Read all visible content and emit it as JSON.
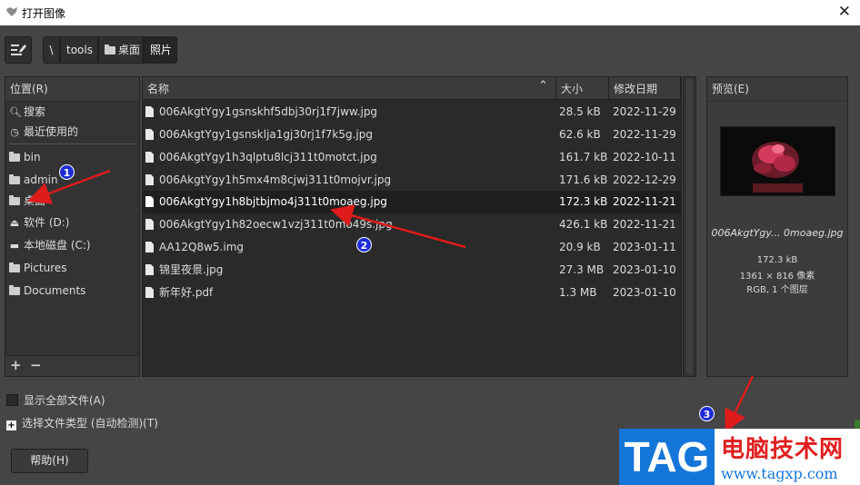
{
  "window": {
    "title": "打开图像",
    "close_icon": "close-icon"
  },
  "breadcrumb": {
    "items": [
      "\\",
      "tools",
      "桌面",
      "照片"
    ]
  },
  "places": {
    "header": "位置(R)",
    "items": [
      {
        "label": "搜索",
        "icon": "search-icon"
      },
      {
        "label": "最近使用的",
        "icon": "recent-icon"
      },
      {
        "label": "bin",
        "icon": "folder-icon"
      },
      {
        "label": "admin",
        "icon": "folder-icon"
      },
      {
        "label": "桌面",
        "icon": "folder-icon"
      },
      {
        "label": "软件 (D:)",
        "icon": "drive-icon"
      },
      {
        "label": "本地磁盘 (C:)",
        "icon": "drive-icon"
      },
      {
        "label": "Pictures",
        "icon": "folder-icon"
      },
      {
        "label": "Documents",
        "icon": "folder-icon"
      }
    ],
    "add_label": "+",
    "remove_label": "−"
  },
  "files": {
    "columns": {
      "name": "名称",
      "size": "大小",
      "date": "修改日期"
    },
    "rows": [
      {
        "name": "006AkgtYgy1gsnskhf5dbj30rj1f7jww.jpg",
        "size": "28.5 kB",
        "date": "2022-11-29"
      },
      {
        "name": "006AkgtYgy1gsnsklja1gj30rj1f7k5g.jpg",
        "size": "62.6 kB",
        "date": "2022-11-29"
      },
      {
        "name": "006AkgtYgy1h3qlptu8lcj311t0motct.jpg",
        "size": "161.7 kB",
        "date": "2022-10-11"
      },
      {
        "name": "006AkgtYgy1h5mx4m8cjwj311t0mojvr.jpg",
        "size": "171.6 kB",
        "date": "2022-12-29"
      },
      {
        "name": "006AkgtYgy1h8bjtbjmo4j311t0moaeg.jpg",
        "size": "172.3 kB",
        "date": "2022-11-21"
      },
      {
        "name": "006AkgtYgy1h82oecw1vzj311t0mo49s.jpg",
        "size": "426.1 kB",
        "date": "2022-11-21"
      },
      {
        "name": "AA12Q8w5.img",
        "size": "20.9 kB",
        "date": "2023-01-11"
      },
      {
        "name": "锦里夜景.jpg",
        "size": "27.3 MB",
        "date": "2023-01-10"
      },
      {
        "name": "新年好.pdf",
        "size": "1.3 MB",
        "date": "2023-01-10"
      }
    ],
    "selected_index": 4
  },
  "preview": {
    "header": "预览(E)",
    "filename": "006AkgtYgy... 0moaeg.jpg",
    "size": "172.3 kB",
    "dimensions": "1361 × 816 像素",
    "mode": "RGB, 1 个图层"
  },
  "options": {
    "show_all": "显示全部文件(A)",
    "file_type": "选择文件类型 (自动检测)(T)"
  },
  "help_button": "帮助(H)",
  "annotations": [
    "1",
    "2",
    "3"
  ],
  "watermark": {
    "tag": "TAG",
    "cn": "电脑技术网",
    "url": "www.tagxp.com"
  },
  "colors": {
    "arrow": "#e01b1b",
    "badge": "#1d2bd6",
    "watermark_blue": "#1576d9",
    "watermark_red": "#e02020"
  }
}
